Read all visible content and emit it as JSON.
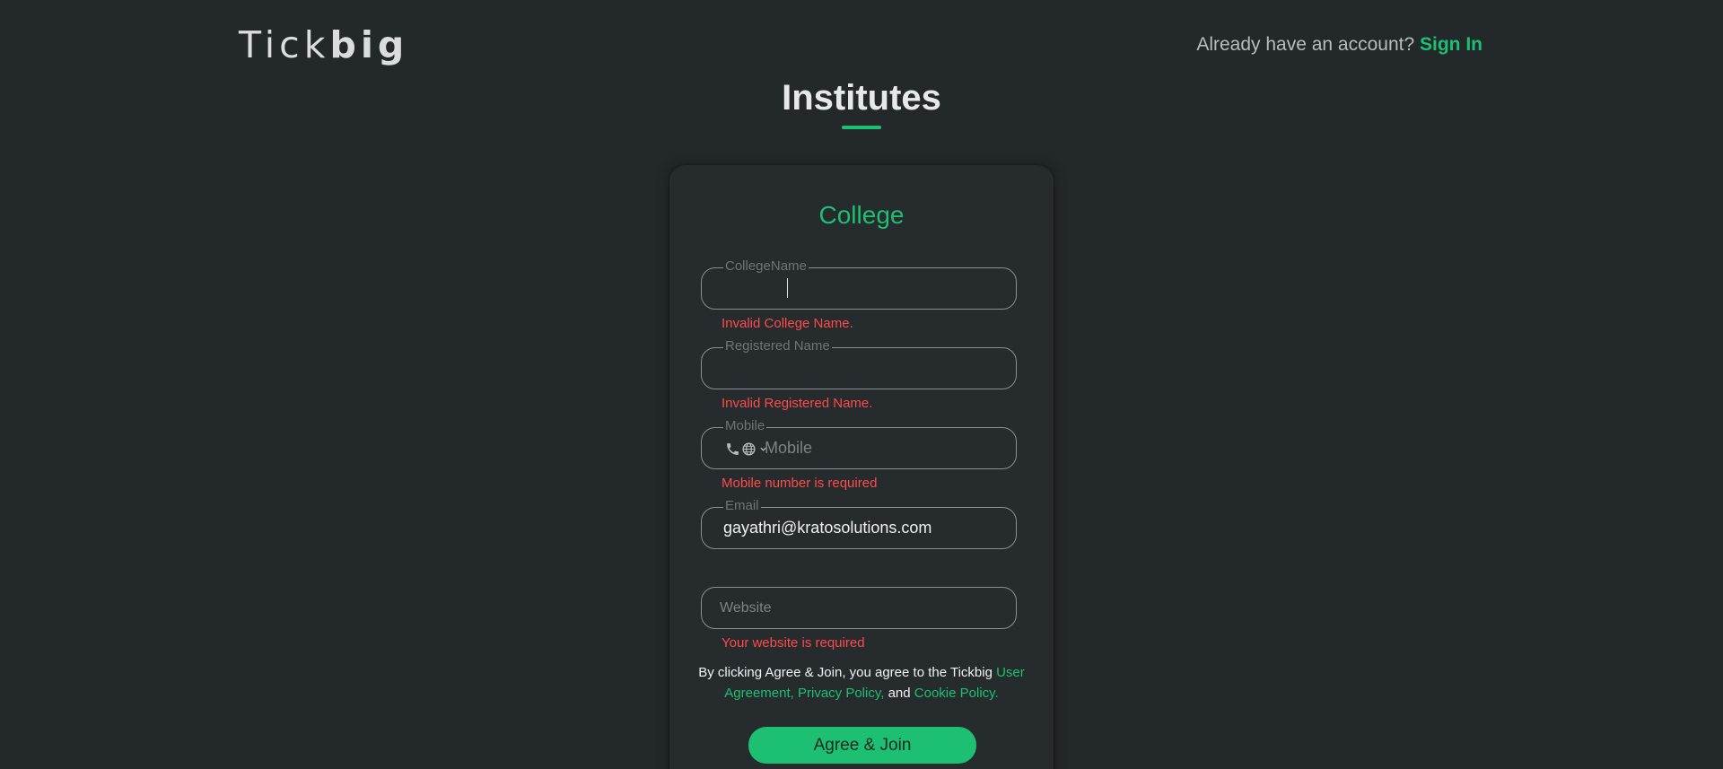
{
  "header": {
    "brand_light": "Tick",
    "brand_bold": "big",
    "signin_prompt": "Already have an account?",
    "signin_link": "Sign In"
  },
  "page": {
    "title": "Institutes"
  },
  "form": {
    "title": "College",
    "college_name": {
      "legend": "CollegeName",
      "value": "",
      "error": "Invalid College Name."
    },
    "registered_name": {
      "legend": "Registered Name",
      "value": "",
      "error": "Invalid Registered Name."
    },
    "mobile": {
      "legend": "Mobile",
      "placeholder": "Mobile",
      "value": "",
      "error": "Mobile number is required"
    },
    "email": {
      "legend": "Email",
      "value": "gayathri@kratosolutions.com"
    },
    "website": {
      "placeholder": "Website",
      "value": "",
      "error": "Your website is required"
    },
    "terms": {
      "prefix": "By clicking Agree & Join, you agree to the Tickbig",
      "user_agreement": "User Agreement,",
      "privacy_policy": "Privacy Policy,",
      "and": "and",
      "cookie_policy": "Cookie Policy."
    },
    "submit_label": "Agree & Join"
  },
  "colors": {
    "accent": "#1dbf73",
    "error": "#ff4b4b",
    "background": "#23282b"
  },
  "icons": [
    "phone-icon",
    "globe-icon",
    "chevron-down-icon"
  ]
}
